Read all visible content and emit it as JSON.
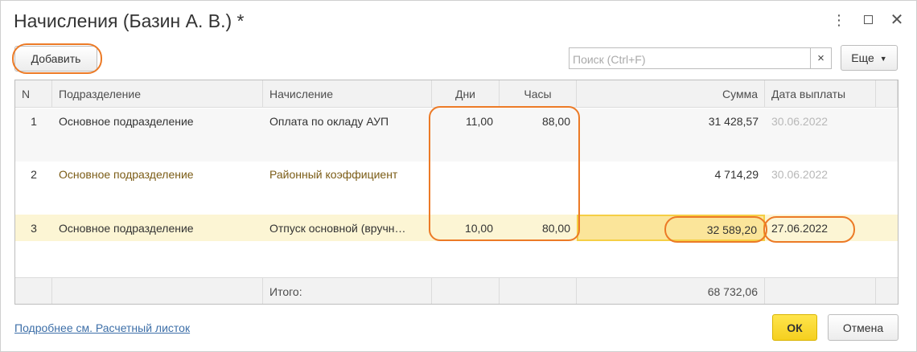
{
  "window": {
    "title": "Начисления (Базин А. В.) *",
    "controls": {
      "more": "⋮",
      "close": "✕"
    }
  },
  "toolbar": {
    "add_label": "Добавить",
    "search_placeholder": "Поиск (Ctrl+F)",
    "search_clear": "×",
    "more_label": "Еще"
  },
  "table": {
    "columns": {
      "n": "N",
      "podr": "Подразделение",
      "nach": "Начисление",
      "dni": "Дни",
      "chas": "Часы",
      "summa": "Сумма",
      "date": "Дата выплаты"
    },
    "rows": [
      {
        "n": "1",
        "podr": "Основное подразделение",
        "nach": "Оплата по окладу АУП",
        "dni": "11,00",
        "chas": "88,00",
        "summa": "31 428,57",
        "date": "30.06.2022"
      },
      {
        "n": "2",
        "podr": "Основное подразделение",
        "nach": "Районный коэффициент",
        "dni": "",
        "chas": "",
        "summa": "4 714,29",
        "date": "30.06.2022"
      },
      {
        "n": "3",
        "podr": "Основное подразделение",
        "nach": "Отпуск основной (вручн…",
        "dni": "10,00",
        "chas": "80,00",
        "summa": "32 589,20",
        "date": "27.06.2022"
      }
    ],
    "footer": {
      "label": "Итого:",
      "summa": "68 732,06"
    }
  },
  "footer": {
    "link_label": "Подробнее см. Расчетный листок",
    "ok_label": "ОК",
    "cancel_label": "Отмена"
  },
  "colors": {
    "highlight_ring": "#ec7a26",
    "ok_button": "#f5cf1f",
    "active_row": "#fcf5d4",
    "link": "#3d6fa8"
  }
}
